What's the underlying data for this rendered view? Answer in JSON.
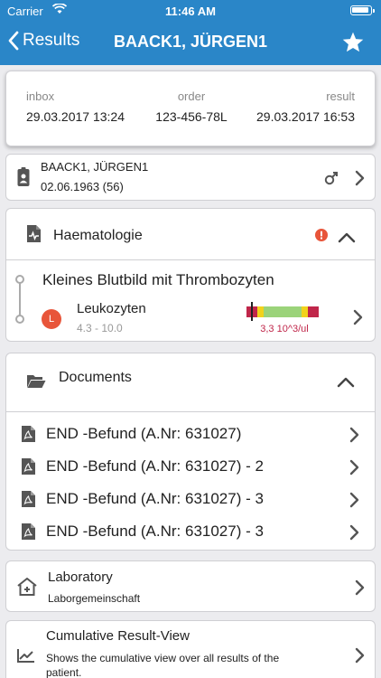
{
  "status_bar": {
    "carrier": "Carrier",
    "time": "11:46 AM"
  },
  "nav": {
    "back_label": "Results",
    "title": "BAACK1, JÜRGEN1"
  },
  "summary": {
    "inbox_label": "inbox",
    "inbox_value": "29.03.2017 13:24",
    "order_label": "order",
    "order_value": "123-456-78L",
    "result_label": "result",
    "result_value": "29.03.2017 16:53"
  },
  "patient": {
    "name": "BAACK1, JÜRGEN1",
    "dob": "02.06.1963 (56)"
  },
  "haematology": {
    "title": "Haematologie",
    "test_name": "Kleines Blutbild mit Thrombozyten",
    "param_name": "Leukozyten",
    "flag": "L",
    "reference_range": "4.3 - 10.0",
    "value_text": "3,3 10^3/ul",
    "value_position_fraction": 0.06
  },
  "documents": {
    "title": "Documents",
    "items": [
      "END -Befund (A.Nr: 631027)",
      "END -Befund (A.Nr: 631027) - 2",
      "END -Befund (A.Nr: 631027) - 3",
      "END -Befund (A.Nr: 631027) - 3"
    ]
  },
  "laboratory": {
    "title": "Laboratory",
    "subtitle": "Laborgemeinschaft"
  },
  "cumulative": {
    "title": "Cumulative Result-View",
    "subtitle": "Shows the cumulative view over all results of the patient."
  },
  "colors": {
    "nav_bar": "#2a86c8",
    "alert": "#e8553a",
    "low_flag": "#e8553a",
    "range_bar_red": "#c0264a",
    "range_bar_yellow": "#f2d21b",
    "range_bar_green": "#9bd37a"
  },
  "icons": [
    "back-chevron-icon",
    "star-icon",
    "wifi-icon",
    "battery-icon",
    "id-card-icon",
    "male-icon",
    "chevron-right-icon",
    "heart-document-icon",
    "alert-icon",
    "chevron-up-icon",
    "folder-icon",
    "pdf-icon",
    "laboratory-house-icon",
    "trend-chart-icon"
  ]
}
